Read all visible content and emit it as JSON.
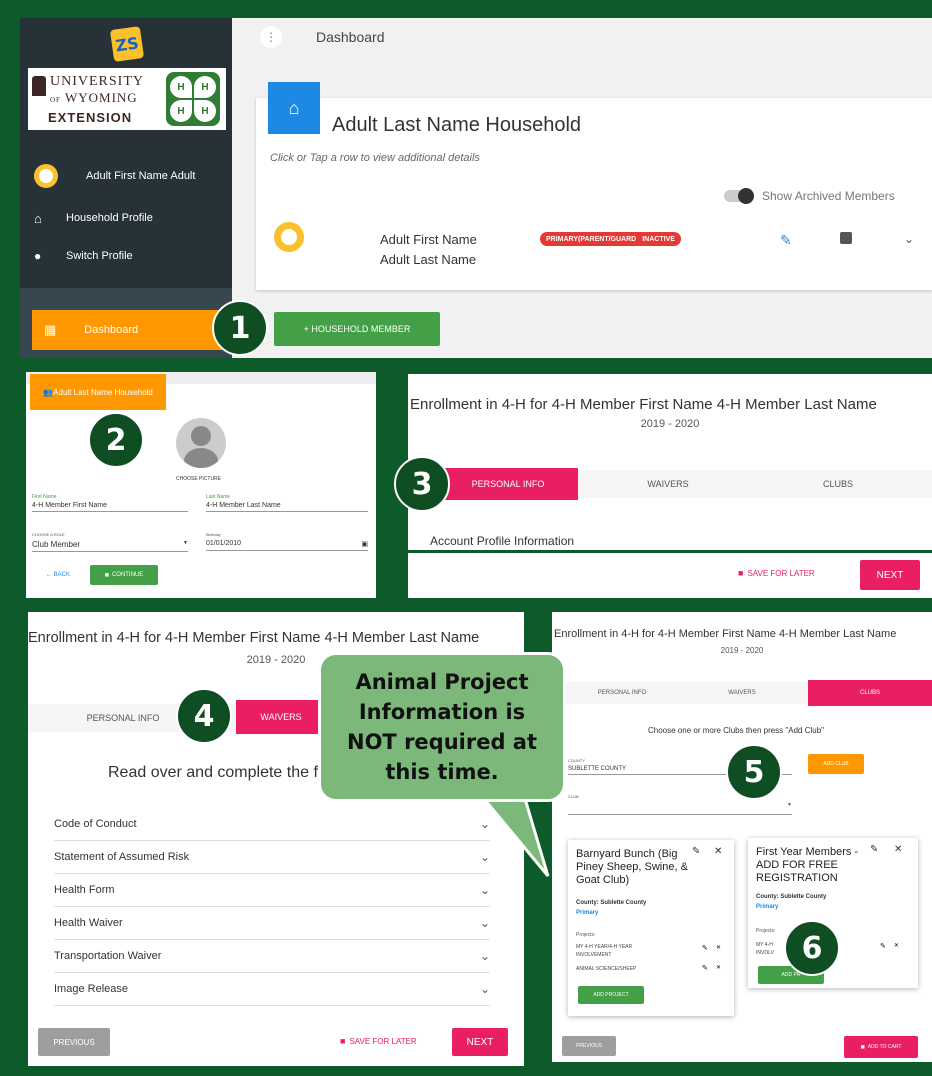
{
  "p1": {
    "header_title": "Dashboard",
    "household_title": "Adult Last Name Household",
    "click_hint": "Click or Tap a row to view additional details",
    "show_archived": "Show Archived Members",
    "member_first": "Adult First Name",
    "member_last": "Adult Last Name",
    "badge_role": "PRIMARY(PARENT/GUARD",
    "badge_status": "INACTIVE",
    "add_member": "+ HOUSEHOLD MEMBER",
    "sidebar_user": "Adult First Name Adult",
    "sidebar_household": "Household Profile",
    "sidebar_switch": "Switch Profile",
    "sidebar_dashboard": "Dashboard",
    "logo_university": "UNIVERSITY",
    "logo_of": "OF",
    "logo_wyoming": "WYOMING",
    "logo_extension": "EXTENSION"
  },
  "p2": {
    "household_button": "Adult Last Name Household",
    "choose_picture": "CHOOSE PICTURE",
    "first_name_label": "First Name",
    "first_name_value": "4-H Member First Name",
    "last_name_label": "Last Name",
    "last_name_value": "4-H Member Last Name",
    "role_label": "CHOOSE A ROLE",
    "role_value": "Club Member",
    "birthday_label": "Birthday",
    "birthday_value": "01/01/2010",
    "back": "← BACK",
    "continue": "CONTINUE"
  },
  "p3": {
    "title": "Enrollment in 4-H for 4-H Member First Name 4-H Member Last Name",
    "year": "2019 - 2020",
    "tab_personal": "PERSONAL INFO",
    "tab_waivers": "WAIVERS",
    "tab_clubs": "CLUBS",
    "account_info": "Account Profile Information",
    "save_later": "SAVE FOR LATER",
    "next": "NEXT"
  },
  "p4": {
    "title": "Enrollment in 4-H for 4-H Member First Name 4-H Member Last Name",
    "year": "2019 - 2020",
    "tab_personal": "PERSONAL INFO",
    "tab_waivers": "WAIVERS",
    "instruction": "Read over and complete the fo",
    "waivers": [
      "Code of Conduct",
      "Statement of Assumed Risk",
      "Health Form",
      "Health Waiver",
      "Transportation Waiver",
      "Image Release"
    ],
    "previous": "PREVIOUS",
    "save_later": "SAVE FOR LATER",
    "next": "NEXT"
  },
  "callout": {
    "text": "Animal Project Information is NOT required at this time."
  },
  "p5": {
    "title": "Enrollment in 4-H for 4-H Member First Name 4-H Member Last Name",
    "year": "2019 - 2020",
    "tab_personal": "PERSONAL INFO",
    "tab_waivers": "WAIVERS",
    "tab_clubs": "CLUBS",
    "instruction": "Choose one or more Clubs then press \"Add Club\"",
    "county_label": "COUNTY",
    "county_value": "SUBLETTE COUNTY",
    "club_label": "CLUB",
    "add_club": "ADD CLUB",
    "card1": {
      "name": "Barnyard Bunch (Big Piney Sheep, Swine, & Goat Club)",
      "county": "County: Sublette County",
      "primary": "Primary",
      "projects_label": "Projects:",
      "project1a": "MY 4-H YEAR/4-H YEAR",
      "project1b": "INVOLVEMENT",
      "project2": "ANIMAL SCIENCE/SHEEP",
      "add_project": "ADD PROJECT"
    },
    "card2": {
      "name": "First Year Members - ADD FOR FREE REGISTRATION",
      "county": "County: Sublette County",
      "primary": "Primary",
      "projects_label": "Projects:",
      "project1a": "MY 4-H",
      "project1b": "INVOLV",
      "add_project": "ADD PR"
    },
    "previous": "PREVIOUS",
    "add_to_cart": "ADD TO CART"
  },
  "steps": [
    "1",
    "2",
    "3",
    "4",
    "5",
    "6"
  ],
  "colors": {
    "green_bg": "#0d5a2a",
    "pink": "#e91e63",
    "orange": "#ff9800",
    "blue": "#1e88e5",
    "green_btn": "#43a047",
    "sidebar": "#263238",
    "callout": "#7cb87a"
  }
}
